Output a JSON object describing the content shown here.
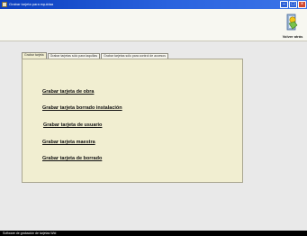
{
  "window": {
    "title": "Grabar tarjeta para equidaa",
    "controls": [
      "minimize",
      "maximize",
      "close"
    ]
  },
  "toolbar": {
    "exit_label": "Volver atrás",
    "exit_icon": "exit-icon"
  },
  "tabs": [
    {
      "label": "Grabar tarjeta",
      "active": true
    },
    {
      "label": "Grabar tarjetas sólo para taquillas",
      "active": false
    },
    {
      "label": "Grabar tarjetas sólo para control de accesos",
      "active": false
    }
  ],
  "actions": [
    "Grabar tarjeta de obra",
    "Grabar tarjeta borrado instalación",
    "Grabar tarjeta de usuario",
    "Grabar tarjeta maestra",
    "Grabar tarjeta de  borrado"
  ],
  "status": {
    "text": "Software de grabación de tarjetas Wid"
  },
  "colors": {
    "desktop": "#07245a",
    "panel": "#f1eed1",
    "titlebar": "#0b3fbf"
  }
}
